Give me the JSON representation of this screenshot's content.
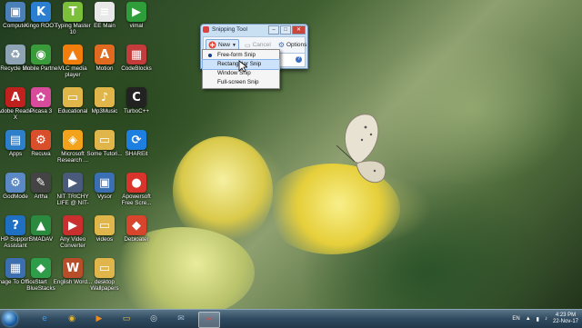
{
  "desktop": {
    "icons": [
      {
        "label": "Computer",
        "icon": "computer-icon",
        "color": "#4a7fb8",
        "glyph": "▣"
      },
      {
        "label": "Kingo ROOT",
        "icon": "kingo-root-icon",
        "color": "#2c7fd0",
        "glyph": "K"
      },
      {
        "label": "Typing Master 10",
        "icon": "typing-master-icon",
        "color": "#7bbf3a",
        "glyph": "T"
      },
      {
        "label": "EE Main",
        "icon": "document-icon",
        "color": "#e8e8e8",
        "glyph": "≡"
      },
      {
        "label": "vimal",
        "icon": "play-icon",
        "color": "#2f9d3a",
        "glyph": "▶"
      },
      {
        "label": "Recycle Bin",
        "icon": "recycle-bin-icon",
        "color": "#8ea3b3",
        "glyph": "♻"
      },
      {
        "label": "Mobile Partner",
        "icon": "mobile-partner-icon",
        "color": "#3a9b3a",
        "glyph": "◉"
      },
      {
        "label": "VLC media player",
        "icon": "vlc-icon",
        "color": "#f07d0c",
        "glyph": "▲"
      },
      {
        "label": "Motion",
        "icon": "motion-icon",
        "color": "#e06a20",
        "glyph": "A"
      },
      {
        "label": "CodeBlocks",
        "icon": "codeblocks-icon",
        "color": "#c43b3b",
        "glyph": "▦"
      },
      {
        "label": "Adobe Reader X",
        "icon": "adobe-reader-icon",
        "color": "#c0201e",
        "glyph": "A"
      },
      {
        "label": "Picasa 3",
        "icon": "picasa-icon",
        "color": "#d84b9b",
        "glyph": "✿"
      },
      {
        "label": "Educational",
        "icon": "folder-icon",
        "color": "#e0b54a",
        "glyph": "▭"
      },
      {
        "label": "Mp3Music",
        "icon": "folder-icon",
        "color": "#e0b54a",
        "glyph": "♪"
      },
      {
        "label": "TurboC++",
        "icon": "turbo-c-icon",
        "color": "#222222",
        "glyph": "C"
      },
      {
        "label": "Apps",
        "icon": "apps-icon",
        "color": "#2e7fc9",
        "glyph": "▤"
      },
      {
        "label": "Recuva",
        "icon": "recuva-icon",
        "color": "#d94f2b",
        "glyph": "⚙"
      },
      {
        "label": "Microsoft Research ...",
        "icon": "microsoft-research-icon",
        "color": "#f2a31b",
        "glyph": "◈"
      },
      {
        "label": "Some Tutori...",
        "icon": "folder-icon",
        "color": "#e0b54a",
        "glyph": "▭"
      },
      {
        "label": "SHAREit",
        "icon": "shareit-icon",
        "color": "#1d7fe0",
        "glyph": "⟳"
      },
      {
        "label": "GodMode",
        "icon": "godmode-icon",
        "color": "#5a89c6",
        "glyph": "⚙"
      },
      {
        "label": "Artha",
        "icon": "artha-icon",
        "color": "#444444",
        "glyph": "✎"
      },
      {
        "label": "NIT TRICHY LIFE @ NIT-",
        "icon": "video-icon",
        "color": "#4a5a7a",
        "glyph": "▶"
      },
      {
        "label": "Vysor",
        "icon": "vysor-icon",
        "color": "#3a6fb3",
        "glyph": "▣"
      },
      {
        "label": "Apowersoft Free Scre...",
        "icon": "apowersoft-icon",
        "color": "#d9342b",
        "glyph": "●"
      },
      {
        "label": "HP Support Assistant",
        "icon": "help-icon",
        "color": "#1f6fc2",
        "glyph": "?"
      },
      {
        "label": "SMADAV",
        "icon": "smadav-icon",
        "color": "#2b8a3e",
        "glyph": "▲"
      },
      {
        "label": "Any Video Converter",
        "icon": "video-converter-icon",
        "color": "#c92f2f",
        "glyph": "▶"
      },
      {
        "label": "videos",
        "icon": "folder-icon",
        "color": "#e0b54a",
        "glyph": "▭"
      },
      {
        "label": "Debloater",
        "icon": "debloater-icon",
        "color": "#d6452c",
        "glyph": "◆"
      },
      {
        "label": "Image To Office",
        "icon": "image-to-office-icon",
        "color": "#3c6fb0",
        "glyph": "▦"
      },
      {
        "label": "Start BlueStacks",
        "icon": "bluestacks-icon",
        "color": "#2f9c4a",
        "glyph": "◆"
      },
      {
        "label": "English Word...",
        "icon": "english-word-icon",
        "color": "#b84d2a",
        "glyph": "W"
      },
      {
        "label": "desktop Wallpapers",
        "icon": "folder-icon",
        "color": "#e0b54a",
        "glyph": "▭"
      }
    ]
  },
  "snipping_tool": {
    "title": "Snipping Tool",
    "new_label": "New",
    "cancel_label": "Cancel",
    "options_label": "Options",
    "help_glyph": "?",
    "minimize_glyph": "–",
    "maximize_glyph": "□",
    "close_glyph": "✕"
  },
  "snip_menu": {
    "items": [
      {
        "label": "Free-form Snip",
        "selected": true
      },
      {
        "label": "Rectangular Snip",
        "highlighted": true
      },
      {
        "label": "Window Snip"
      },
      {
        "label": "Full-screen Snip"
      }
    ]
  },
  "taskbar": {
    "items": [
      {
        "icon": "internet-explorer-icon",
        "glyph": "e",
        "color": "#3d9be9"
      },
      {
        "icon": "chrome-icon",
        "glyph": "◉",
        "color": "#e4b52c"
      },
      {
        "icon": "media-player-icon",
        "glyph": "▶",
        "color": "#f08a1e"
      },
      {
        "icon": "file-explorer-icon",
        "glyph": "▭",
        "color": "#e5c15a"
      },
      {
        "icon": "webcam-icon",
        "glyph": "◎",
        "color": "#cfd6dd"
      },
      {
        "icon": "mail-icon",
        "glyph": "✉",
        "color": "#9bb8d0"
      },
      {
        "icon": "snipping-tool-icon",
        "glyph": "✂",
        "color": "#e24b4b"
      }
    ],
    "language": "EN",
    "time": "4:23 PM",
    "date": "22-Nov-17"
  },
  "colors": {
    "accent": "#3b6fc4",
    "menu_highlight": "#cde3fb"
  }
}
